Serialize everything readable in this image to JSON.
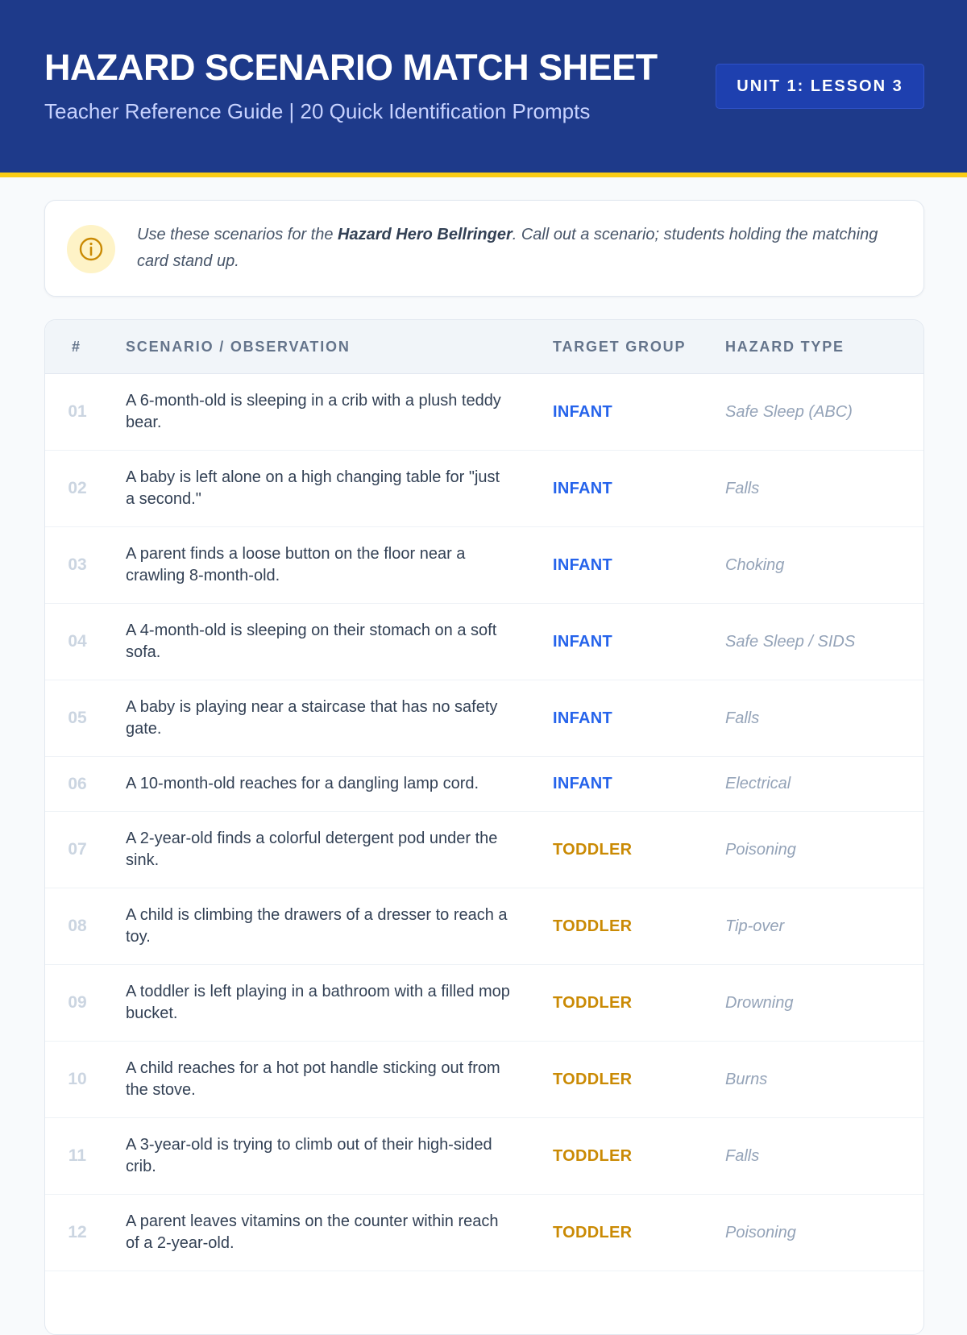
{
  "header": {
    "title": "HAZARD SCENARIO MATCH SHEET",
    "subtitle": "Teacher Reference Guide | 20 Quick Identification Prompts",
    "badge": "UNIT 1: LESSON 3"
  },
  "note": {
    "icon": "info-icon",
    "text_before": "Use these scenarios for the ",
    "text_bold": "Hazard Hero Bellringer",
    "text_after": ". Call out a scenario; students holding the matching card stand up."
  },
  "table": {
    "columns": [
      "#",
      "SCENARIO / OBSERVATION",
      "TARGET GROUP",
      "HAZARD TYPE"
    ],
    "group_colors": {
      "INFANT": "#2563eb",
      "TODDLER": "#ca8a04"
    },
    "rows": [
      {
        "num": "01",
        "scenario": "A 6-month-old is sleeping in a crib with a plush teddy bear.",
        "group": "INFANT",
        "type": "Safe Sleep (ABC)"
      },
      {
        "num": "02",
        "scenario": "A baby is left alone on a high changing table for \"just a second.\"",
        "group": "INFANT",
        "type": "Falls"
      },
      {
        "num": "03",
        "scenario": "A parent finds a loose button on the floor near a crawling 8-month-old.",
        "group": "INFANT",
        "type": "Choking"
      },
      {
        "num": "04",
        "scenario": "A 4-month-old is sleeping on their stomach on a soft sofa.",
        "group": "INFANT",
        "type": "Safe Sleep / SIDS"
      },
      {
        "num": "05",
        "scenario": "A baby is playing near a staircase that has no safety gate.",
        "group": "INFANT",
        "type": "Falls"
      },
      {
        "num": "06",
        "scenario": "A 10-month-old reaches for a dangling lamp cord.",
        "group": "INFANT",
        "type": "Electrical"
      },
      {
        "num": "07",
        "scenario": "A 2-year-old finds a colorful detergent pod under the sink.",
        "group": "TODDLER",
        "type": "Poisoning"
      },
      {
        "num": "08",
        "scenario": "A child is climbing the drawers of a dresser to reach a toy.",
        "group": "TODDLER",
        "type": "Tip-over"
      },
      {
        "num": "09",
        "scenario": "A toddler is left playing in a bathroom with a filled mop bucket.",
        "group": "TODDLER",
        "type": "Drowning"
      },
      {
        "num": "10",
        "scenario": "A child reaches for a hot pot handle sticking out from the stove.",
        "group": "TODDLER",
        "type": "Burns"
      },
      {
        "num": "11",
        "scenario": "A 3-year-old is trying to climb out of their high-sided crib.",
        "group": "TODDLER",
        "type": "Falls"
      },
      {
        "num": "12",
        "scenario": "A parent leaves vitamins on the counter within reach of a 2-year-old.",
        "group": "TODDLER",
        "type": "Poisoning"
      }
    ]
  }
}
